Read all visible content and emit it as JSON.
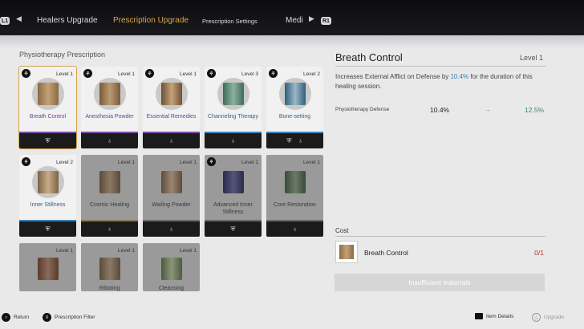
{
  "nav": {
    "l1": "L1",
    "tab_healers": "Healers Upgrade",
    "tab_prescription": "Prescription Upgrade",
    "tab_settings": "Prescription Settings",
    "tab_medi": "Medi",
    "r1": "R1"
  },
  "grid": {
    "title": "Physiotherapy Prescription",
    "cards": [
      {
        "name": "Breath Control",
        "level": "Level 1"
      },
      {
        "name": "Anesthesia Powder",
        "level": "Level 1"
      },
      {
        "name": "Essential Remedies",
        "level": "Level 1"
      },
      {
        "name": "Channeling Therapy",
        "level": "Level 3"
      },
      {
        "name": "Bone-setting",
        "level": "Level 2"
      },
      {
        "name": "Inner Stillness",
        "level": "Level 2"
      },
      {
        "name": "Cosmic Healing",
        "level": "Level 1"
      },
      {
        "name": "Wailing Powder",
        "level": "Level 1"
      },
      {
        "name": "Advanced Inner Stillness",
        "level": "Level 1"
      },
      {
        "name": "Core Restoration",
        "level": "Level 1"
      },
      {
        "name": "",
        "level": "Level 1"
      },
      {
        "name": "Riboting",
        "level": "Level 1"
      },
      {
        "name": "Cleansing",
        "level": "Level 1"
      }
    ]
  },
  "detail": {
    "title": "Breath Control",
    "level": "Level 1",
    "desc_prefix": "Increases External Afflict on Defense by ",
    "desc_value": "10.4%",
    "desc_suffix": " for the duration of this healing session.",
    "stat_label": "Physiotherapy Defense",
    "stat_current": "10.4%",
    "stat_arrow": "→",
    "stat_next": "12.5%"
  },
  "cost": {
    "label": "Cost",
    "item_name": "Breath Control",
    "quantity": "0/1",
    "insufficient": "Insufficient materials"
  },
  "footer": {
    "return": "Return",
    "filter": "Prescription Filter",
    "item_details": "Item Details",
    "upgrade": "Upgrade"
  },
  "colors": {
    "accent": "#d9a64d",
    "highlight": "#3c7ea8",
    "increase": "#3b8a5a",
    "missing": "#b03030"
  }
}
